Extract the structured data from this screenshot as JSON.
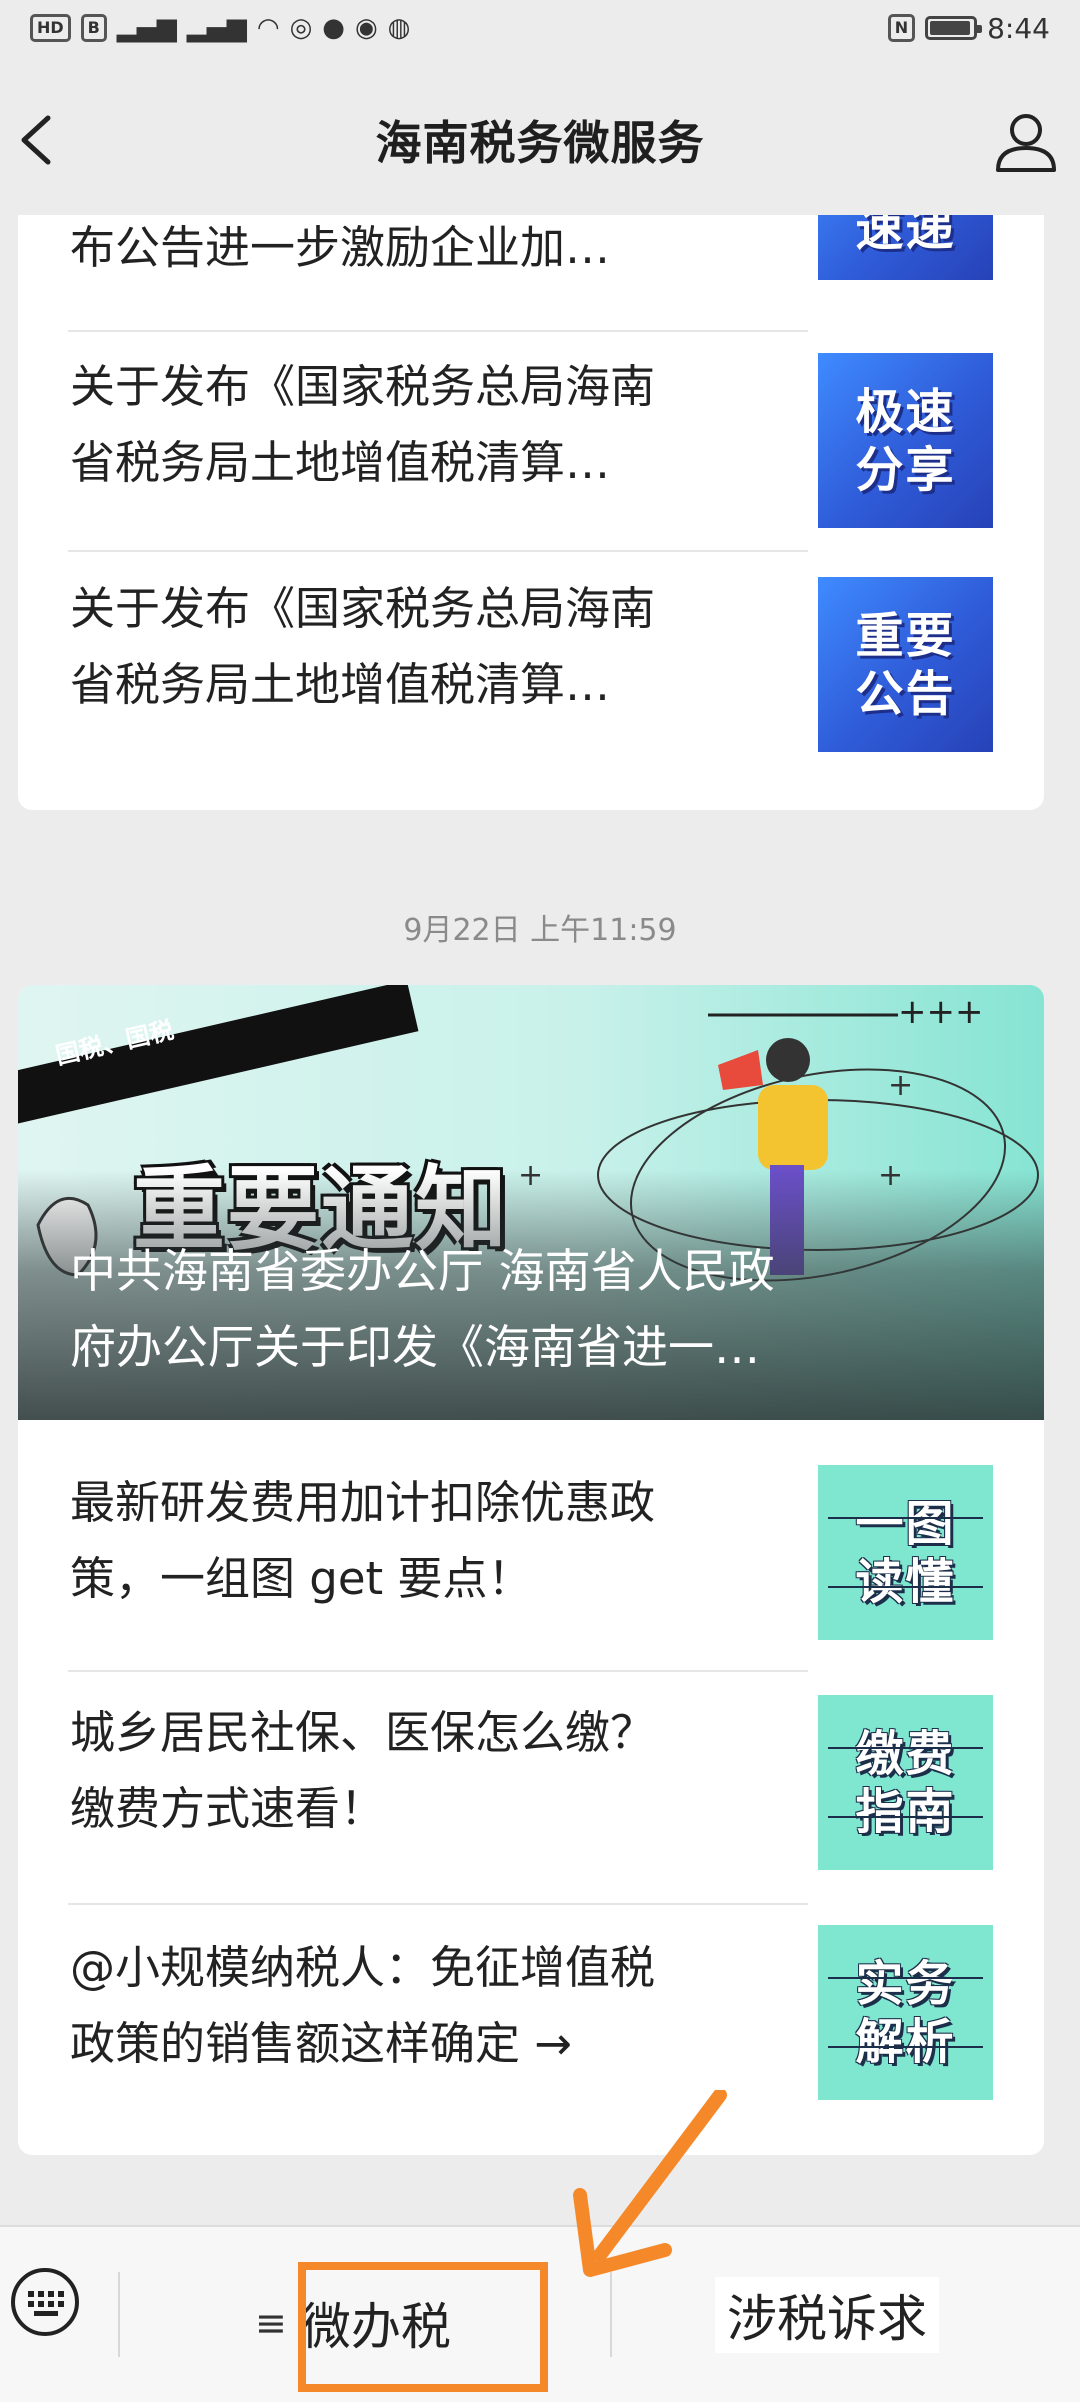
{
  "status_bar": {
    "time": "8:44",
    "left_icons": [
      "hd-icon",
      "signal-4g-icon",
      "signal-5g-icon",
      "wifi-icon",
      "app-icon",
      "app-icon",
      "app-icon",
      "app-icon"
    ],
    "hd_label": "HD",
    "b_label": "B",
    "nfc_label": "N"
  },
  "nav": {
    "title": "海南税务微服务"
  },
  "card1": {
    "rows": [
      {
        "text_line1": "布公告进一步激励企业加…",
        "text_line2": "",
        "thumb_line1": "速递",
        "thumb_line2": "",
        "thumb_style": "blue"
      },
      {
        "text_line1": "关于发布《国家税务总局海南",
        "text_line2": "省税务局土地增值税清算…",
        "thumb_line1": "极速",
        "thumb_line2": "分享",
        "thumb_style": "blue"
      },
      {
        "text_line1": "关于发布《国家税务总局海南",
        "text_line2": "省税务局土地增值税清算…",
        "thumb_line1": "重要",
        "thumb_line2": "公告",
        "thumb_style": "blue"
      }
    ]
  },
  "timestamp": "9月22日 上午11:59",
  "card2": {
    "banner": {
      "ribbon_text": "国税、国税",
      "heading": "重要通知",
      "caption_line1": "中共海南省委办公厅 海南省人民政",
      "caption_line2": "府办公厅关于印发《海南省进一…"
    },
    "rows": [
      {
        "text_line1": "最新研发费用加计扣除优惠政",
        "text_line2": "策，一组图 get 要点！",
        "thumb_line1": "一图",
        "thumb_line2": "读懂",
        "thumb_style": "teal"
      },
      {
        "text_line1": "城乡居民社保、医保怎么缴？",
        "text_line2": "缴费方式速看！",
        "thumb_line1": "缴费",
        "thumb_line2": "指南",
        "thumb_style": "teal"
      },
      {
        "text_line1": "@小规模纳税人：免征增值税",
        "text_line2": "政策的销售额这样确定 →",
        "thumb_line1": "实务",
        "thumb_line2": "解析",
        "thumb_style": "teal"
      }
    ]
  },
  "bottom_bar": {
    "menu1_glyph": "≡",
    "menu1_label": "微办税",
    "menu2_label": "涉税诉求"
  },
  "colors": {
    "highlight": "#f5892a",
    "thumb_blue": "#2f5bd8",
    "thumb_teal": "#7fe6d0"
  }
}
